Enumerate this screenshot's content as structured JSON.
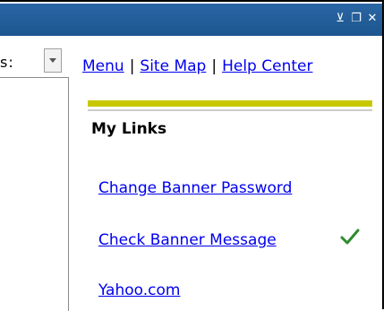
{
  "window": {
    "buttons": [
      {
        "name": "minimize-icon",
        "glyph": "⊻"
      },
      {
        "name": "restore-icon",
        "glyph": "❐"
      },
      {
        "name": "close-icon",
        "glyph": "✕"
      }
    ]
  },
  "left": {
    "label_fragment": "s:"
  },
  "nav": {
    "menu": "Menu",
    "separator": "|",
    "site_map": "Site Map",
    "help_center": "Help Center"
  },
  "my_links": {
    "title": "My Links",
    "items": [
      "Change Banner Password",
      "Check Banner Message",
      "Yahoo.com"
    ],
    "status_icon": "green-checkmark-icon"
  },
  "colors": {
    "titlebar": "#1d568f",
    "link": "#0000ee",
    "accent_bar": "#c8c800",
    "checkmark": "#2e8b2e"
  }
}
